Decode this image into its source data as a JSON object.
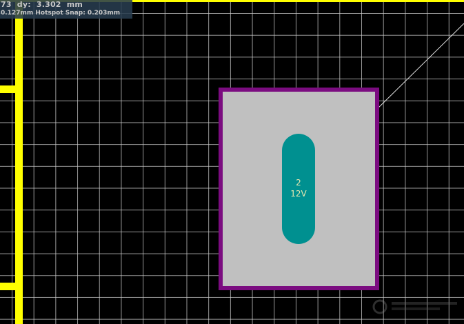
{
  "hud": {
    "line1": "73  dy:  3.302  mm",
    "line2": "0.127mm Hotspot Snap: 0.203mm"
  },
  "pad": {
    "number": "2",
    "net": "12V"
  },
  "colors": {
    "background": "#000000",
    "grid": "#cdcdcd",
    "board_outline": "#ffff00",
    "pad_outline": "#7b0c80",
    "pad_fill": "#c0c0c0",
    "pad_hole": "#009090",
    "pad_label": "#e8e8b0"
  }
}
